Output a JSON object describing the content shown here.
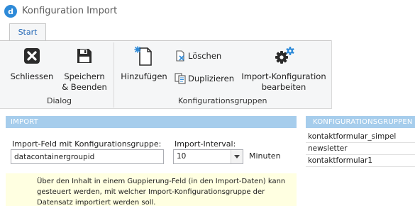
{
  "window": {
    "title": "Konfiguration Import"
  },
  "tabs": [
    {
      "label": "Start",
      "active": true
    }
  ],
  "ribbon": {
    "groups": [
      {
        "label": "Dialog"
      },
      {
        "label": "Konfigurationsgruppen"
      }
    ],
    "buttons": {
      "close": {
        "label": "Schliessen",
        "icon": "close-x-icon"
      },
      "save": {
        "label_line1": "Speichern",
        "label_line2": "& Beenden",
        "icon": "floppy-disk-icon"
      },
      "add": {
        "label": "Hinzufügen",
        "icon": "new-document-icon"
      },
      "delete": {
        "label": "Löschen",
        "icon": "delete-document-icon"
      },
      "duplicate": {
        "label": "Duplizieren",
        "icon": "duplicate-document-icon"
      },
      "edit": {
        "label_line1": "Import-Konfiguration",
        "label_line2": "bearbeiten",
        "icon": "gears-icon"
      }
    }
  },
  "import": {
    "header": "IMPORT",
    "field_label": "Import-Feld mit Konfigurationsgruppe:",
    "field_value": "datacontainergroupid",
    "interval_label": "Import-Interval:",
    "interval_value": "10",
    "interval_unit": "Minuten",
    "info": "Über den Inhalt in einem Guppierung-Feld (in den Import-Daten) kann gesteuert werden, mit welcher Import-Konfigurationsgruppe der Datensatz importiert werden soll."
  },
  "groups_panel": {
    "header": "KONFIGURATIONSGRUPPEN",
    "items": [
      "kontaktformular_simpel",
      "newsletter",
      "kontaktformular1"
    ]
  },
  "colors": {
    "accent": "#1e64b4",
    "section_header": "#a6cdec",
    "info_background": "#ffffe1",
    "app_icon": "#2e8ad8"
  }
}
